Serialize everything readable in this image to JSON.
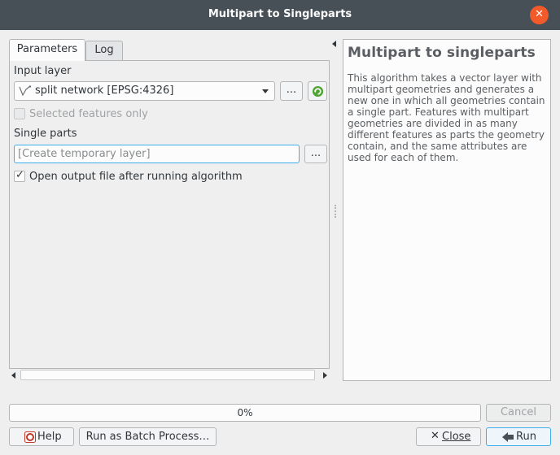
{
  "window": {
    "title": "Multipart to Singleparts"
  },
  "tabs": [
    {
      "label": "Parameters"
    },
    {
      "label": "Log"
    }
  ],
  "params": {
    "input_layer_label": "Input layer",
    "input_layer_value": "split network [EPSG:4326]",
    "browse_label": "...",
    "selected_only_label": "Selected features only",
    "single_parts_label": "Single parts",
    "output_placeholder": "[Create temporary layer]",
    "open_output_label": "Open output file after running algorithm",
    "open_output_check": "✓"
  },
  "help": {
    "title": "Multipart to singleparts",
    "body": "This algorithm takes a vector layer with multipart geometries and generates a new one in which all geometries contain a single part. Features with multipart geometries are divided in as many different features as parts the geometry contain, and the same attributes are used for each of them."
  },
  "progress": {
    "percent": 0,
    "text": "0%"
  },
  "buttons": {
    "cancel": "Cancel",
    "help": "Help",
    "batch": "Run as Batch Process…",
    "close": "Close",
    "run": "Run"
  },
  "colors": {
    "titlebar": "#475057",
    "close": "#f25a2a",
    "accent": "#3daee9"
  }
}
